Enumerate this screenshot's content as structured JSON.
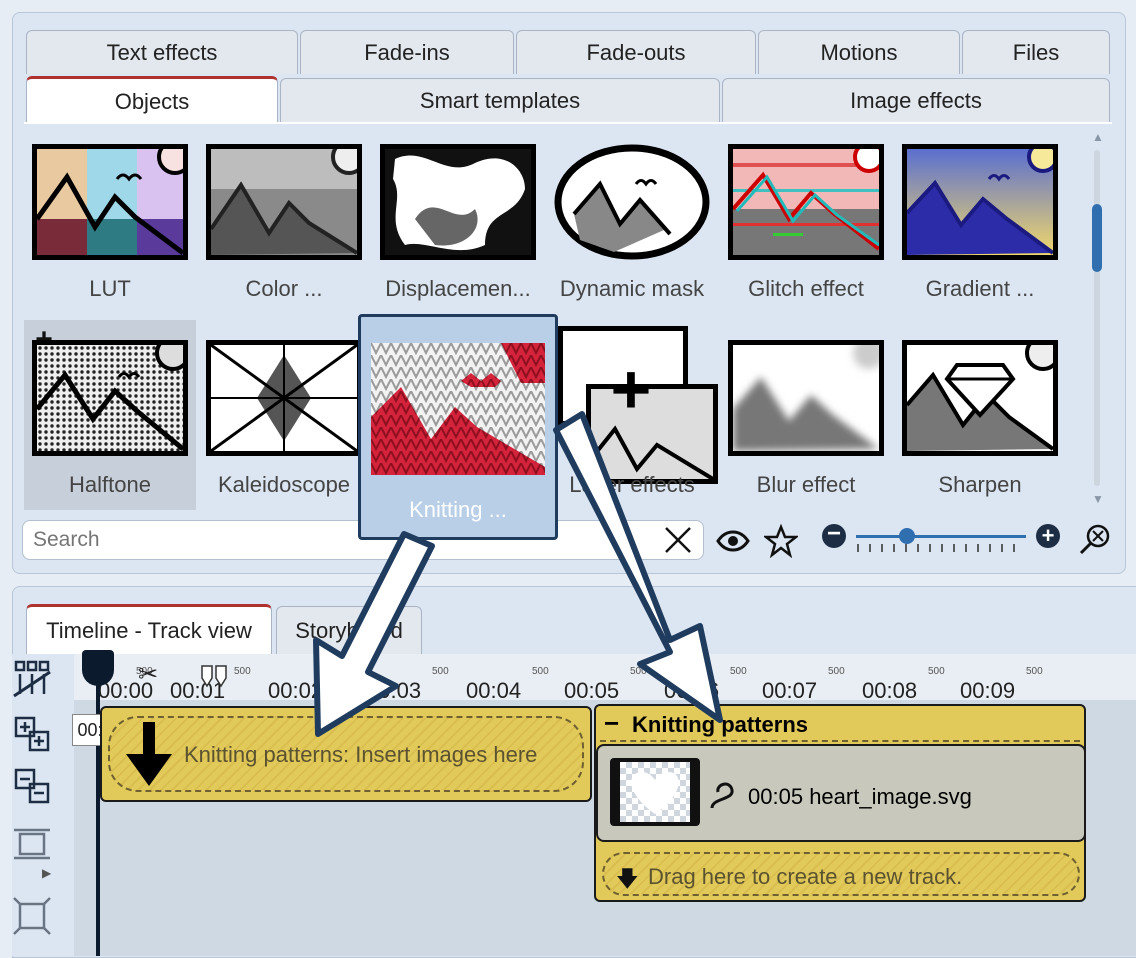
{
  "tabs_row1": [
    {
      "label": "Text effects"
    },
    {
      "label": "Fade-ins"
    },
    {
      "label": "Fade-outs"
    },
    {
      "label": "Motions"
    },
    {
      "label": "Files"
    }
  ],
  "tabs_row2": [
    {
      "label": "Objects",
      "active": true
    },
    {
      "label": "Smart templates"
    },
    {
      "label": "Image effects"
    }
  ],
  "effects": [
    {
      "label": "LUT",
      "icon": "lut-thumbnail-icon"
    },
    {
      "label": "Color ...",
      "icon": "color-thumbnail-icon"
    },
    {
      "label": "Displacemen...",
      "icon": "displacement-thumbnail-icon"
    },
    {
      "label": "Dynamic mask",
      "icon": "dynamic-mask-thumbnail-icon"
    },
    {
      "label": "Glitch effect",
      "icon": "glitch-thumbnail-icon"
    },
    {
      "label": "Gradient ...",
      "icon": "gradient-thumbnail-icon"
    },
    {
      "label": "Halftone",
      "icon": "halftone-thumbnail-icon",
      "selected": true
    },
    {
      "label": "Kaleidoscope",
      "icon": "kaleidoscope-thumbnail-icon"
    },
    {
      "label": "",
      "icon": "knitting-slot-thumbnail-icon"
    },
    {
      "label": "Layer effects",
      "icon": "layer-effects-thumbnail-icon"
    },
    {
      "label": "Blur effect",
      "icon": "blur-thumbnail-icon"
    },
    {
      "label": "Sharpen",
      "icon": "sharpen-thumbnail-icon"
    }
  ],
  "drag_tile": {
    "label": "Knitting ...",
    "icon": "knitting-thumbnail-icon"
  },
  "search": {
    "placeholder": "Search"
  },
  "zoom": {
    "level": 0.3
  },
  "timeline_tabs": [
    {
      "label": "Timeline - Track view",
      "active": true
    },
    {
      "label": "Storyboard"
    }
  ],
  "ruler": {
    "labels": [
      "00:00",
      "00:01",
      "00:02",
      "00:03",
      "00:04",
      "00:05",
      "00:06",
      "00:07",
      "00:08",
      "00:09"
    ],
    "sub": "500"
  },
  "playhead_time": "00:00",
  "track1": {
    "hint": "Knitting patterns: Insert images here"
  },
  "track2": {
    "title": "Knitting patterns",
    "clip_duration": "00:05",
    "clip_name": "heart_image.svg",
    "drop_hint": "Drag here to create a new track."
  },
  "colors": {
    "accent": "#2f6fb0",
    "track": "#e2ca5a",
    "active_tab": "#b0322e"
  }
}
